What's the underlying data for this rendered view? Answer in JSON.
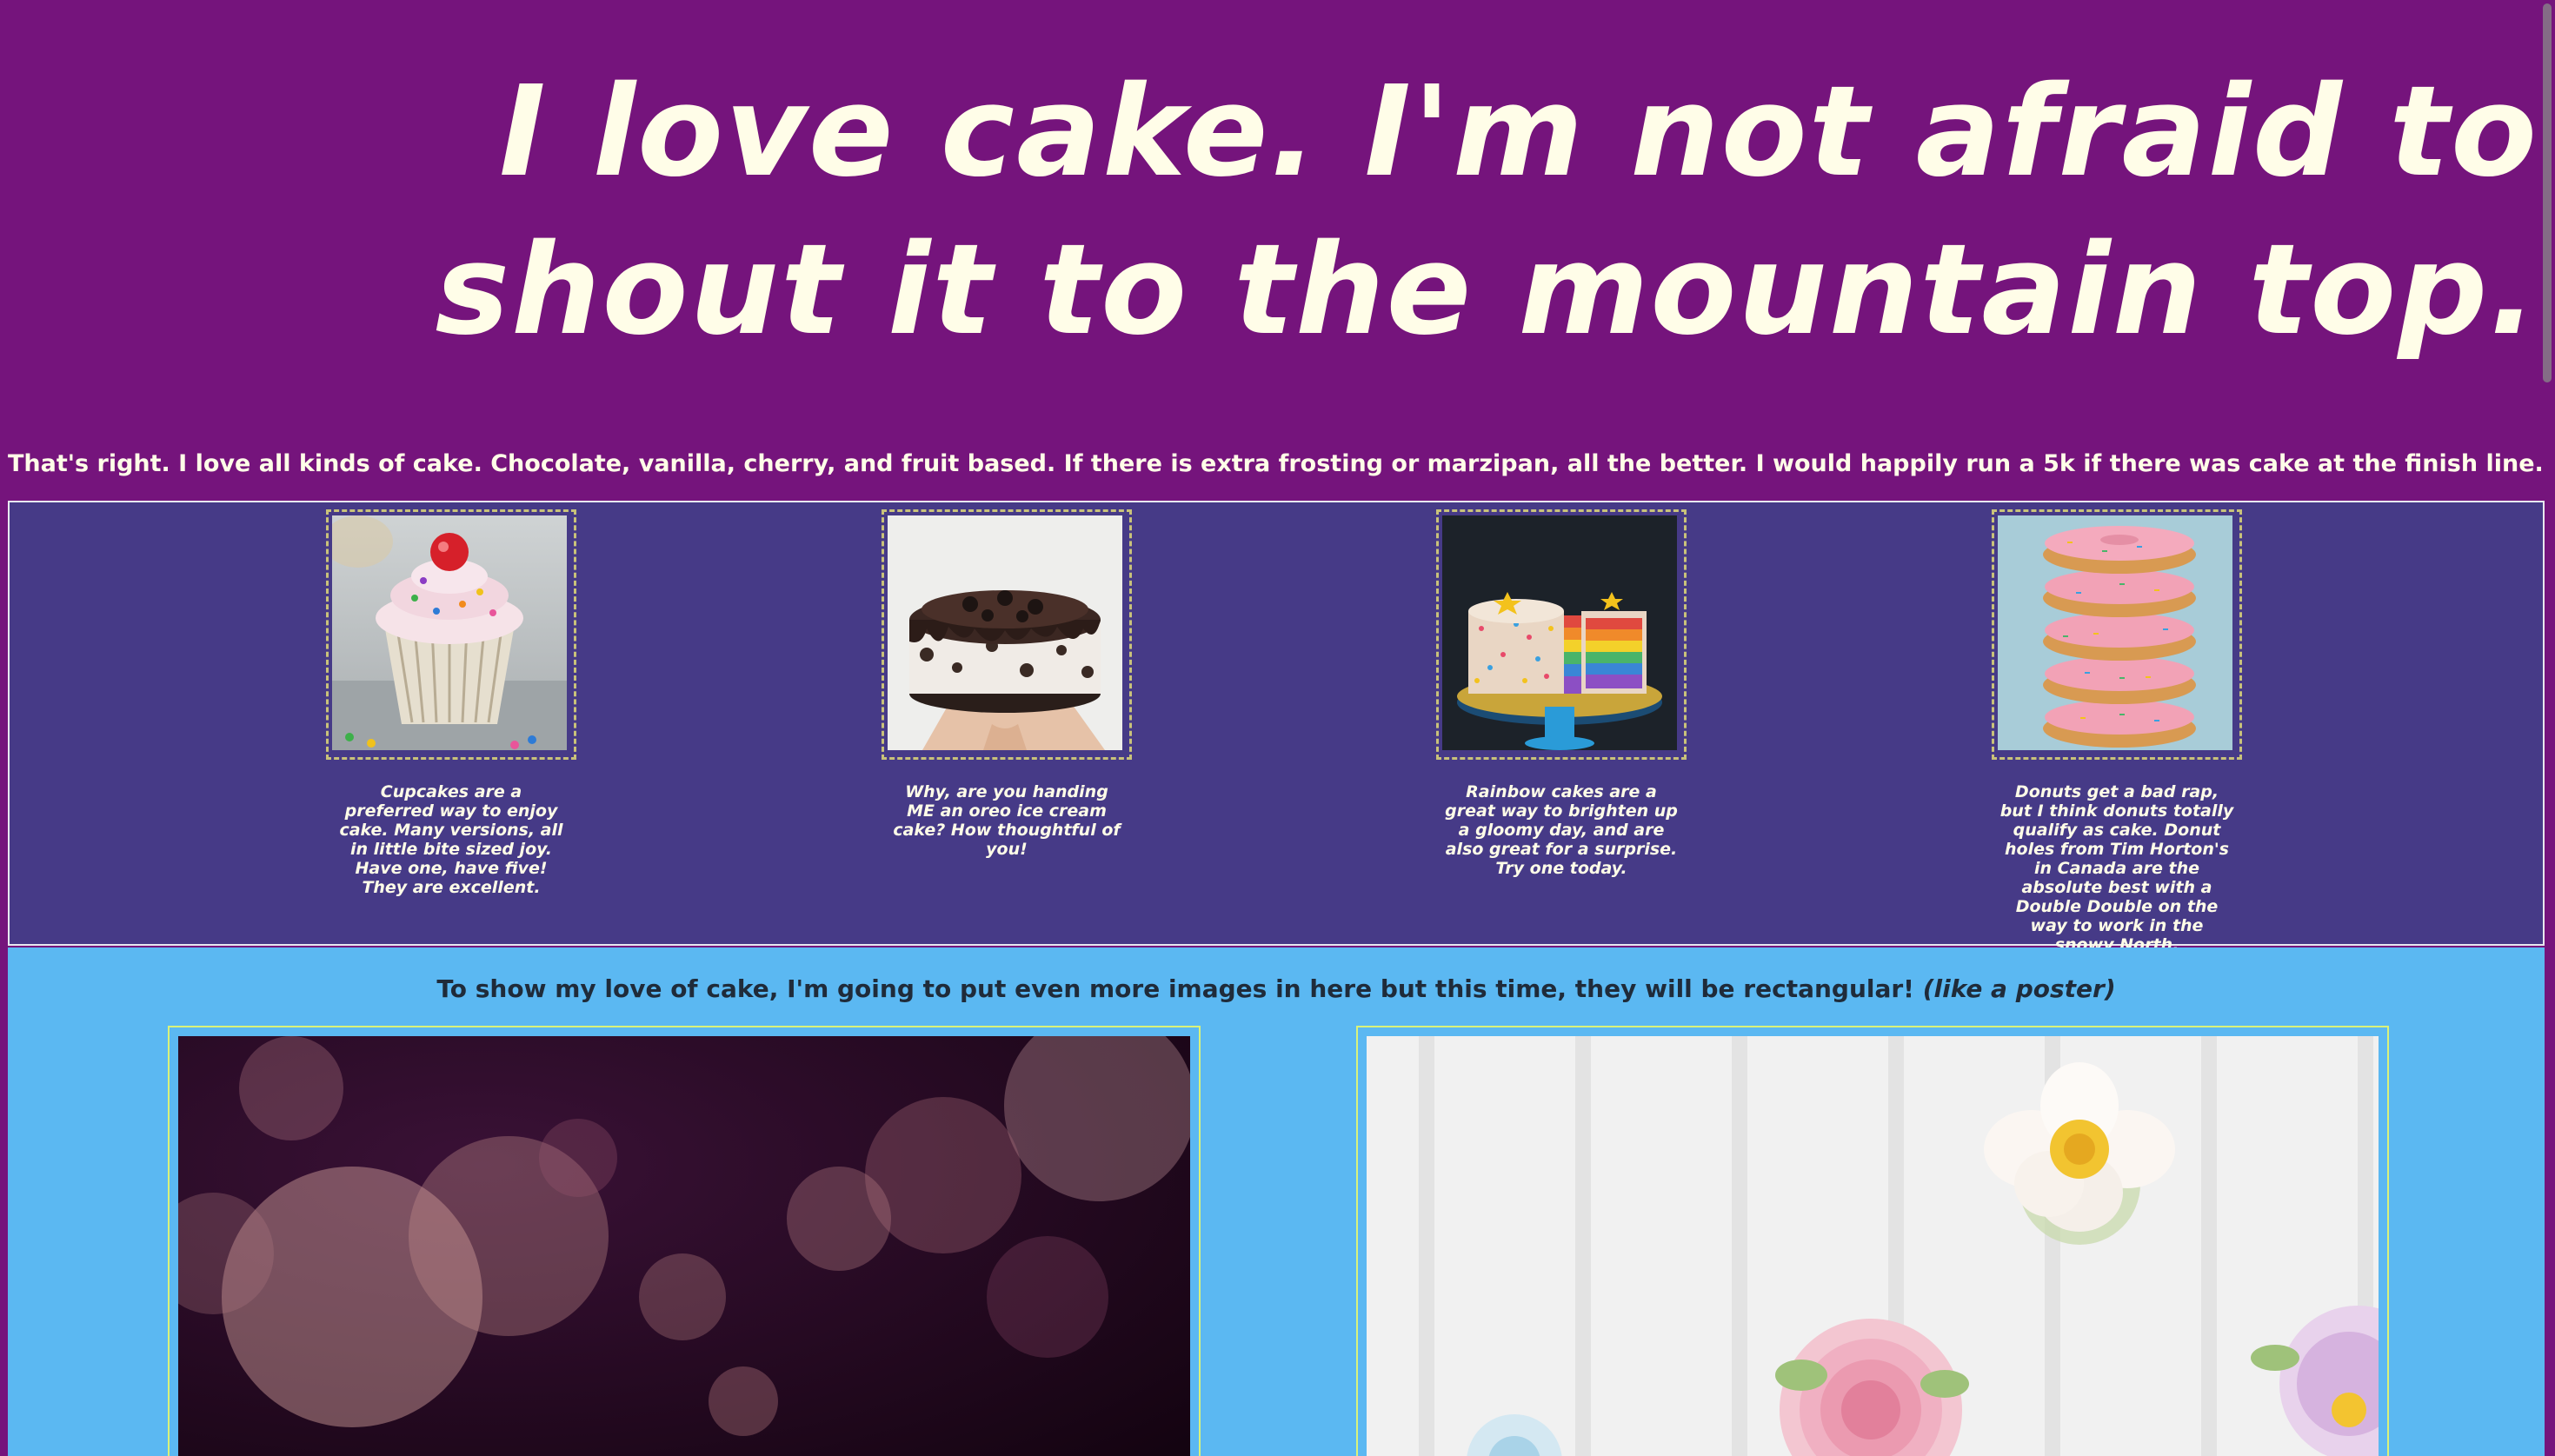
{
  "header": {
    "title_line1": "I love cake. I'm not afraid to",
    "title_line2": "shout it to the mountain top."
  },
  "intro": {
    "text": "That's right. I love all kinds of cake. Chocolate, vanilla, cherry, and fruit based. If there is extra frosting or marzipan, all the better. I would happily run a 5k if there was cake at the finish line."
  },
  "gallery": {
    "items": [
      {
        "image": "cupcake-photo",
        "caption": "Cupcakes are a preferred way to enjoy cake. Many versions, all in little bite sized joy. Have one, have five! They are excellent."
      },
      {
        "image": "oreo-ice-cream-cake-photo",
        "caption": "Why, are you handing ME an oreo ice cream cake? How thoughtful of you!"
      },
      {
        "image": "rainbow-cake-photo",
        "caption": "Rainbow cakes are a great way to brighten up a gloomy day, and are also great for a surprise. Try one today."
      },
      {
        "image": "donut-stack-photo",
        "caption": "Donuts get a bad rap, but I think donuts totally qualify as cake. Donut holes from Tim Horton's in Canada are the absolute best with a Double Double on the way to work in the snowy North."
      }
    ]
  },
  "posters": {
    "heading": "To show my love of cake, I'm going to put even more images in here but this time, they will be rectangular!",
    "heading_emphasis": "(like a poster)",
    "items": [
      {
        "image": "bokeh-lights-photo"
      },
      {
        "image": "flower-cupcakes-photo"
      }
    ]
  },
  "colors": {
    "page_background": "#75147c",
    "hero_text": "#fffde8",
    "gallery_background": "#463a87",
    "poster_section_background": "#5bb8f2",
    "poster_border": "#d9f27a",
    "thumb_border": "#c9c27a"
  }
}
